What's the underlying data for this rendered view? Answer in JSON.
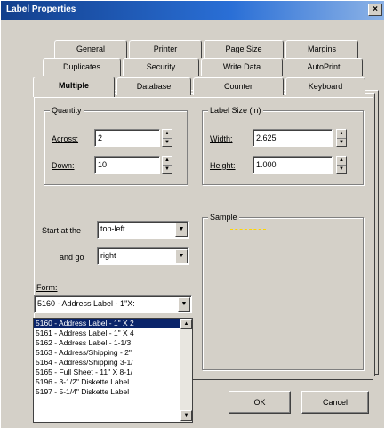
{
  "window": {
    "title": "Label Properties",
    "close_glyph": "×"
  },
  "tabs_row1": [
    "General",
    "Printer",
    "Page Size",
    "Margins"
  ],
  "tabs_row2": [
    "Duplicates",
    "Security",
    "Write Data",
    "AutoPrint"
  ],
  "tabs_row3": [
    "Multiple",
    "Database",
    "Counter",
    "Keyboard"
  ],
  "active_tab": "Multiple",
  "quantity": {
    "legend": "Quantity",
    "across_label": "Across:",
    "across_value": "2",
    "down_label": "Down:",
    "down_value": "10"
  },
  "label_size": {
    "legend": "Label Size (in)",
    "width_label": "Width:",
    "width_value": "2.625",
    "height_label": "Height:",
    "height_value": "1.000"
  },
  "start": {
    "label": "Start at the",
    "value": "top-left"
  },
  "go": {
    "label": "and go",
    "value": "right"
  },
  "sample": {
    "legend": "Sample"
  },
  "form": {
    "label": "Form:",
    "value": "5160 - Address Label - 1\"X:",
    "options": [
      "5160 - Address Label - 1\" X 2",
      "5161 - Address Label - 1\" X 4",
      "5162 - Address Label - 1-1/3",
      "5163 - Address/Shipping - 2\"",
      "5164 - Address/Shipping 3-1/",
      "5165 - Full Sheet - 11\" X 8-1/",
      "5196 - 3-1/2\" Diskette Label",
      "5197 - 5-1/4\" Diskette Label"
    ],
    "selected_index": 0
  },
  "buttons": {
    "ok": "OK",
    "cancel": "Cancel"
  },
  "colors": {
    "title_start": "#123f8c",
    "title_end": "#8db3e6",
    "selection": "#0a246a",
    "face": "#d4d0c8"
  }
}
